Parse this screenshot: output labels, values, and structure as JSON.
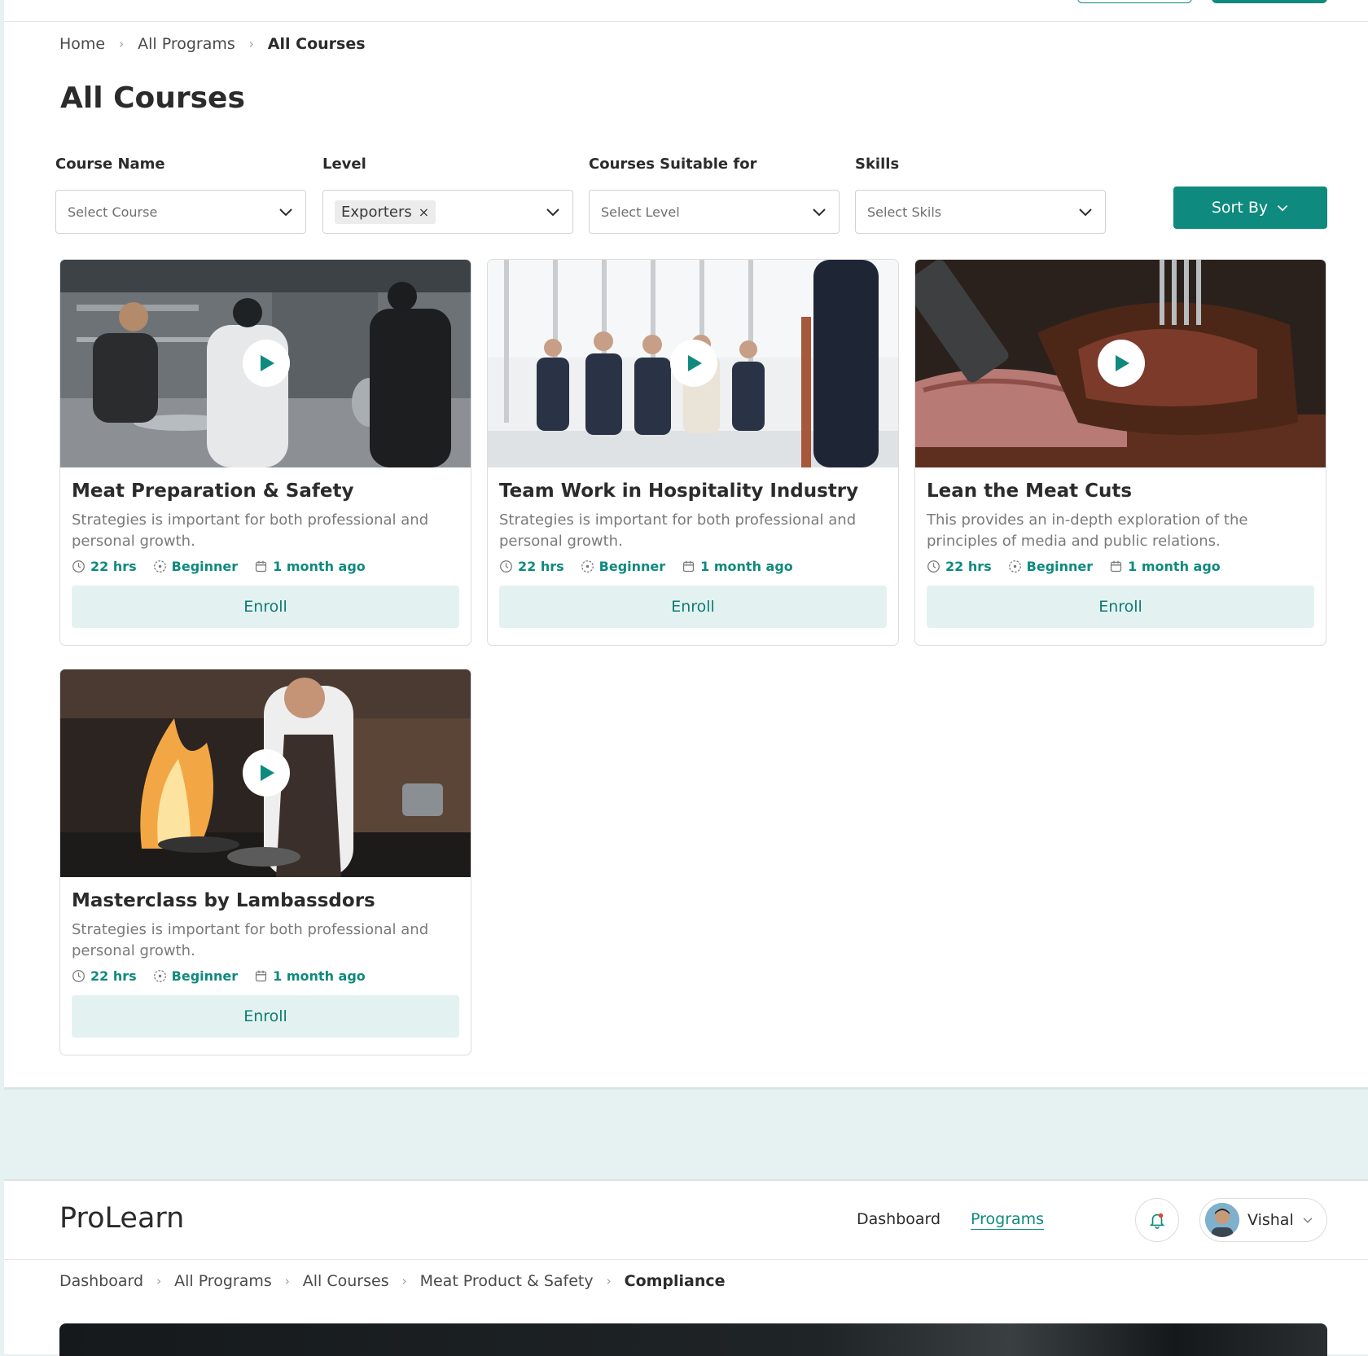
{
  "colors": {
    "accent": "#0f8a7e",
    "accent_soft": "#e3f2f1",
    "page_bg": "#e6f2f1"
  },
  "breadcrumb": [
    "Home",
    "All Programs",
    "All Courses"
  ],
  "page_title": "All Courses",
  "filters": [
    {
      "label": "Course Name",
      "placeholder": "Select Course",
      "selected": ""
    },
    {
      "label": "Level",
      "placeholder": "",
      "selected": "Exporters"
    },
    {
      "label": "Courses Suitable for",
      "placeholder": "Select Level",
      "selected": ""
    },
    {
      "label": "Skills",
      "placeholder": "Select Skils",
      "selected": ""
    }
  ],
  "chip_remove": "×",
  "sort_button": "Sort By",
  "courses": [
    {
      "title": "Meat Preparation & Safety",
      "description": "Strategies is important for both professional and personal growth.",
      "duration": "22 hrs",
      "level": "Beginner",
      "posted": "1 month ago",
      "enroll": "Enroll",
      "image": "kitchen-chefs-photo"
    },
    {
      "title": "Team Work in Hospitality Industry",
      "description": "Strategies is important for both professional and personal growth.",
      "duration": "22 hrs",
      "level": "Beginner",
      "posted": "1 month ago",
      "enroll": "Enroll",
      "image": "seminar-audience-photo"
    },
    {
      "title": "Lean the Meat Cuts",
      "description": "This provides an in-depth exploration of the principles of media and public relations.",
      "duration": "22 hrs",
      "level": "Beginner",
      "posted": "1 month ago",
      "enroll": "Enroll",
      "image": "sliced-steak-photo"
    },
    {
      "title": "Masterclass by Lambassdors",
      "description": "Strategies is important for both professional and personal growth.",
      "duration": "22 hrs",
      "level": "Beginner",
      "posted": "1 month ago",
      "enroll": "Enroll",
      "image": "flambe-chef-photo"
    }
  ],
  "nav": {
    "logo": "ProLearn",
    "links": [
      "Dashboard",
      "Programs"
    ],
    "active_link": "Programs",
    "user_name": "Vishal"
  },
  "breadcrumb2": [
    "Dashboard",
    "All Programs",
    "All Courses",
    "Meat Product & Safety",
    "Compliance"
  ]
}
